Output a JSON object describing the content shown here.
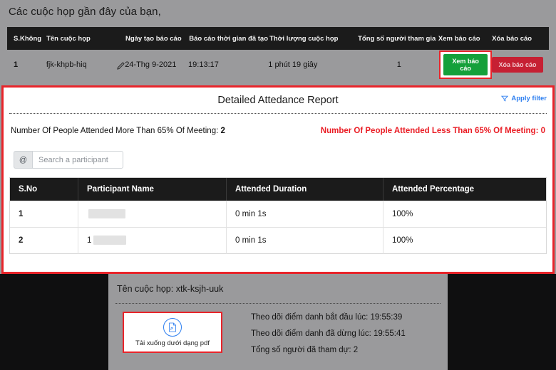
{
  "page": {
    "heading": "Các cuộc họp gần đây của bạn,"
  },
  "meetings_table": {
    "columns": [
      "S.Không",
      "Tên cuộc họp",
      "Ngày tạo báo cáo",
      "Báo cáo thời gian đã tạo",
      "Thời lượng cuộc họp",
      "Tổng số người tham gia",
      "Xem báo cáo",
      "Xóa báo cáo"
    ],
    "row": {
      "sno": "1",
      "meeting_name": "fjk-khpb-hiq",
      "report_date": "24-Thg 9-2021",
      "report_time": "19:13:17",
      "duration": "1 phút 19 giây",
      "participants": "1",
      "view_button": "Xem báo cáo",
      "delete_button": "Xóa báo cáo"
    },
    "edit_icon": "pencil-icon"
  },
  "report": {
    "title": "Detailed Attedance Report",
    "apply_filter": "Apply filter",
    "filter_icon": "funnel-icon",
    "stat_more": "Number Of People Attended More Than 65% Of Meeting:",
    "stat_more_value": "2",
    "stat_less": "Number Of People Attended Less Than 65% Of Meeting: 0",
    "stat_neg_color": "#ea1d25",
    "search": {
      "addon": "@",
      "placeholder": "Search a participant",
      "value": ""
    },
    "table": {
      "columns": [
        "S.No",
        "Participant Name",
        "Attended Duration",
        "Attended Percentage"
      ],
      "rows": [
        {
          "sno": "1",
          "name_prefix": "",
          "name_redacted": true,
          "duration": "0 min 1s",
          "percentage": "100%"
        },
        {
          "sno": "2",
          "name_prefix": "1",
          "name_redacted": true,
          "duration": "0 min 1s",
          "percentage": "100%"
        }
      ]
    }
  },
  "summary": {
    "meeting_name_label": "Tên cuộc họp: xtk-ksjh-uuk",
    "download_icon": "pdf-file-icon",
    "download_label": "Tải xuống dưới dạng pdf",
    "start_line": "Theo dõi điểm danh bắt đầu lúc: 19:55:39",
    "stop_line": "Theo dõi điểm danh đã dừng lúc: 19:55:41",
    "total_line": "Tổng số người đã tham dự: 2"
  }
}
